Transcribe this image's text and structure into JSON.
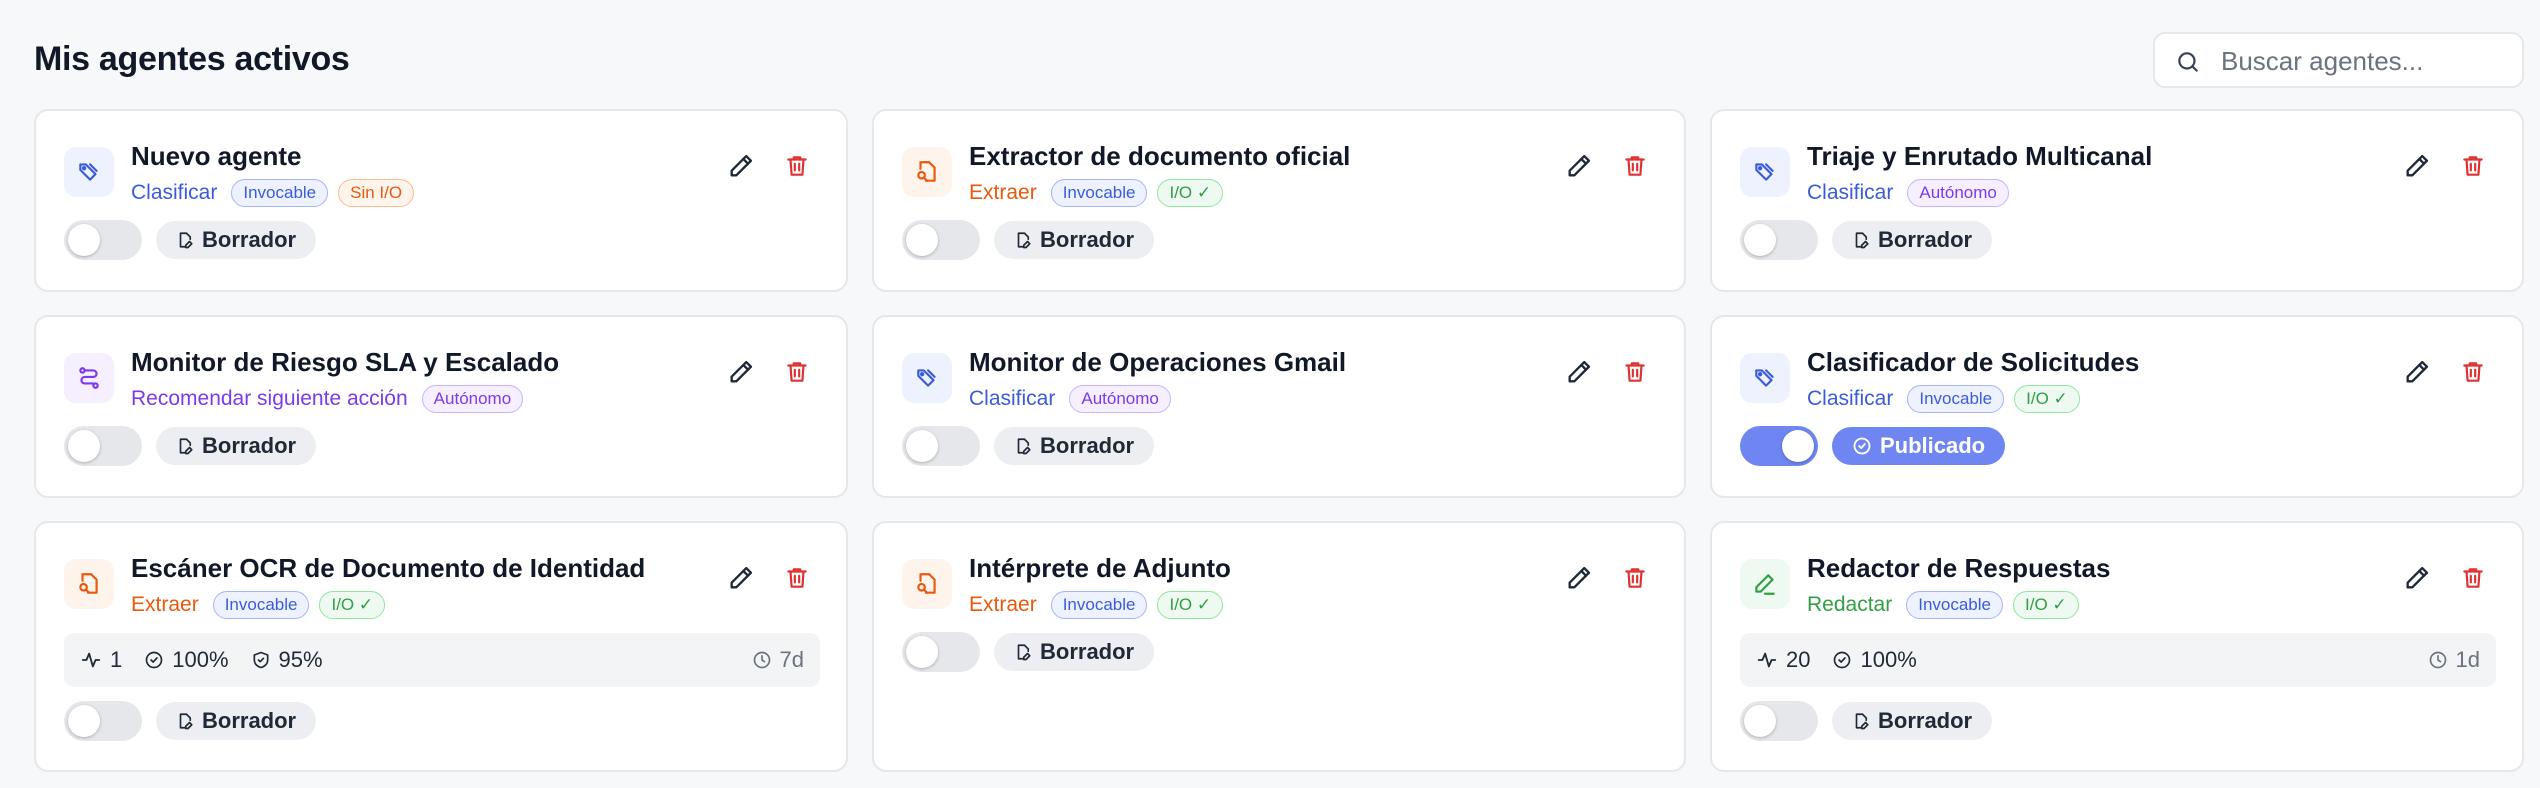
{
  "header": {
    "title": "Mis agentes activos",
    "search_placeholder": "Buscar agentes..."
  },
  "cards": [
    {
      "name": "Nuevo agente",
      "type": "Clasificar",
      "badges": [
        "Invocable",
        "Sin I/O"
      ],
      "status": "Borrador",
      "enabled": false
    },
    {
      "name": "Extractor de documento oficial",
      "type": "Extraer",
      "badges": [
        "Invocable",
        "I/O ✓"
      ],
      "status": "Borrador",
      "enabled": false
    },
    {
      "name": "Triaje y Enrutado Multicanal",
      "type": "Clasificar",
      "badges": [
        "Autónomo"
      ],
      "status": "Borrador",
      "enabled": false
    },
    {
      "name": "Monitor de Riesgo SLA y Escalado",
      "type": "Recomendar siguiente acción",
      "badges": [
        "Autónomo"
      ],
      "status": "Borrador",
      "enabled": false
    },
    {
      "name": "Monitor de Operaciones Gmail",
      "type": "Clasificar",
      "badges": [
        "Autónomo"
      ],
      "status": "Borrador",
      "enabled": false
    },
    {
      "name": "Clasificador de Solicitudes",
      "type": "Clasificar",
      "badges": [
        "Invocable",
        "I/O ✓"
      ],
      "status": "Publicado",
      "enabled": true
    },
    {
      "name": "Escáner OCR de Documento de Identidad",
      "type": "Extraer",
      "badges": [
        "Invocable",
        "I/O ✓"
      ],
      "status": "Borrador",
      "enabled": false,
      "stats": {
        "runs": "1",
        "success": "100%",
        "confidence": "95%",
        "age": "7d"
      }
    },
    {
      "name": "Intérprete de Adjunto",
      "type": "Extraer",
      "badges": [
        "Invocable",
        "I/O ✓"
      ],
      "status": "Borrador",
      "enabled": false
    },
    {
      "name": "Redactor de Respuestas",
      "type": "Redactar",
      "badges": [
        "Invocable",
        "I/O ✓"
      ],
      "status": "Borrador",
      "enabled": false,
      "stats": {
        "runs": "20",
        "success": "100%",
        "age": "1d"
      }
    }
  ],
  "icons": {
    "search": "search-icon",
    "classify": "tag-icon",
    "extract": "document-search-icon",
    "recommend": "route-icon",
    "draft": "pencil-line-icon",
    "edit": "pencil-icon",
    "delete": "trash-icon",
    "draft_status": "file-edit-icon",
    "published_status": "check-circle-icon",
    "runs": "activity-icon",
    "success": "check-circle-icon",
    "confidence": "shield-check-icon",
    "age": "clock-icon"
  },
  "colors": {
    "accent": "#6f86f2",
    "classify": "#3b5bdb",
    "extract": "#e8590c",
    "recommend": "#7c3aed",
    "draft": "#2f9e44",
    "delete": "#e03131"
  }
}
